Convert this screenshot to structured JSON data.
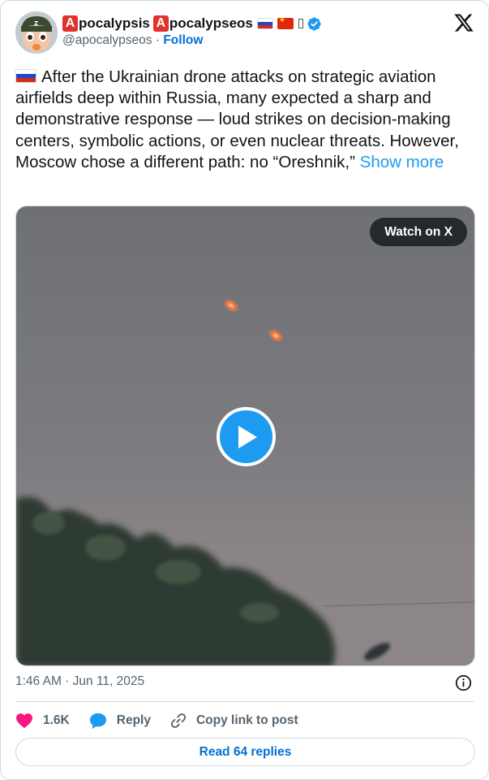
{
  "author": {
    "name_part1": "pocalypsis",
    "name_part2": "pocalypseos",
    "badge_letter": "A",
    "handle": "@apocalypseos",
    "separator": "·",
    "follow_label": "Follow",
    "verified": true
  },
  "tweet": {
    "text": "After the Ukrainian drone attacks on strategic aviation airfields deep within Russia, many expected a sharp and demonstrative response — loud strikes on decision-making centers, symbolic actions, or even nuclear threats. However, Moscow chose a different path: no “Oreshnik,”",
    "show_more_label": "Show more"
  },
  "media": {
    "watch_label": "Watch on X",
    "type": "video"
  },
  "meta": {
    "timestamp": "1:46 AM · Jun 11, 2025"
  },
  "actions": {
    "likes": "1.6K",
    "reply_label": "Reply",
    "copy_label": "Copy link to post",
    "read_replies_label": "Read 64 replies"
  },
  "colors": {
    "accent": "#1d9bf0",
    "link": "#006fd6",
    "like": "#f91880",
    "badge": "#e0322b",
    "secondary_text": "#536471"
  },
  "icons": [
    "avatar",
    "verified-badge-icon",
    "x-logo-icon",
    "play-icon",
    "info-icon",
    "heart-icon",
    "reply-bubble-icon",
    "link-icon"
  ]
}
